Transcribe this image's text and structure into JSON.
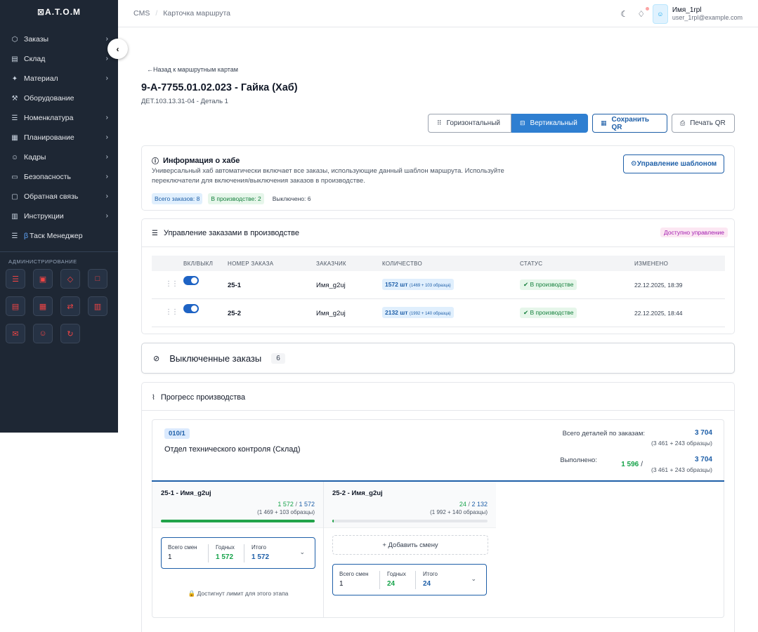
{
  "brand": {
    "logo": "⊠A.T.O.M"
  },
  "sidebar": {
    "items": [
      {
        "icon": "box-icon",
        "glyph": "⬡",
        "label": "Заказы",
        "chevron": true
      },
      {
        "icon": "warehouse-icon",
        "glyph": "▤",
        "label": "Склад",
        "chevron": true
      },
      {
        "icon": "material-icon",
        "glyph": "✦",
        "label": "Материал",
        "chevron": true
      },
      {
        "icon": "tools-icon",
        "glyph": "⚒",
        "label": "Оборудование",
        "chevron": false
      },
      {
        "icon": "list-icon",
        "glyph": "☰",
        "label": "Номенклатура",
        "chevron": true
      },
      {
        "icon": "calendar-icon",
        "glyph": "▦",
        "label": "Планирование",
        "chevron": true
      },
      {
        "icon": "users-icon",
        "glyph": "☺",
        "label": "Кадры",
        "chevron": true
      },
      {
        "icon": "monitor-icon",
        "glyph": "▭",
        "label": "Безопасность",
        "chevron": true
      },
      {
        "icon": "chat-icon",
        "glyph": "▢",
        "label": "Обратная связь",
        "chevron": true
      },
      {
        "icon": "book-icon",
        "glyph": "▥",
        "label": "Инструкции",
        "chevron": true
      }
    ],
    "task_manager": {
      "beta": "β",
      "label": "Таск Менеджер"
    },
    "admin_title": "АДМИНИСТРИРОВАНИЕ",
    "admin_icons": [
      {
        "icon": "list-admin-icon",
        "glyph": "☰"
      },
      {
        "icon": "lock-admin-icon",
        "glyph": "▣"
      },
      {
        "icon": "shield-admin-icon",
        "glyph": "◇"
      },
      {
        "icon": "file-admin-icon",
        "glyph": "□"
      },
      {
        "icon": "database-admin-icon",
        "glyph": "▤"
      },
      {
        "icon": "table-admin-icon",
        "glyph": "▦"
      },
      {
        "icon": "route-admin-icon",
        "glyph": "⇄"
      },
      {
        "icon": "printer-admin-icon",
        "glyph": "▥"
      },
      {
        "icon": "mail-admin-icon",
        "glyph": "✉"
      },
      {
        "icon": "user-admin-icon",
        "glyph": "☺"
      },
      {
        "icon": "refresh-admin-icon",
        "glyph": "↻"
      }
    ]
  },
  "header": {
    "breadcrumb": [
      "CMS",
      "Карточка маршрута"
    ],
    "user_name": "Имя_1rpl",
    "user_email": "user_1rpl@example.com"
  },
  "page": {
    "back_label": "←Назад к маршрутным картам",
    "title": "9-A-7755.01.02.023 - Гайка (Хаб)",
    "subtitle": "ДЕТ.103.13.31-04 - Деталь 1",
    "btn_horizontal": "Горизонтальный",
    "btn_vertical": "Вертикальный",
    "btn_save_qr": "Сохранить QR",
    "btn_print_qr": "Печать QR"
  },
  "info": {
    "title": "Информация о хабе",
    "text": "Универсальный хаб автоматически включает все заказы, использующие данный шаблон маршрута. Используйте переключатели для включения/выключения заказов в производстве.",
    "chip_total": "Всего заказов: 8",
    "chip_production": "В производстве: 2",
    "chip_off": "Выключено: 6",
    "btn_template": "⚙Управление шаблоном"
  },
  "orders": {
    "title": "Управление заказами в производстве",
    "badge": "Доступно управление",
    "columns": [
      "ВКЛ/ВЫКЛ",
      "НОМЕР ЗАКАЗА",
      "ЗАКАЗЧИК",
      "КОЛИЧЕСТВО",
      "СТАТУС",
      "ИЗМЕНЕНО"
    ],
    "rows": [
      {
        "number": "25-1",
        "customer": "Имя_g2uj",
        "qty": "1572 шт",
        "qty_note": "(1469 + 103 образца)",
        "status": "✔ В производстве",
        "changed": "22.12.2025, 18:39"
      },
      {
        "number": "25-2",
        "customer": "Имя_g2uj",
        "qty": "2132 шт",
        "qty_note": "(1992 + 140 образца)",
        "status": "✔ В производстве",
        "changed": "22.12.2025, 18:44"
      }
    ]
  },
  "excluded": {
    "title": "Выключенные заказы",
    "count": "6"
  },
  "progress": {
    "title": "Прогресс производства",
    "stage_code": "010/1",
    "stage_name": "Отдел технического контроля (Склад)",
    "total_label": "Всего деталей по заказам:",
    "total_value": "3 704",
    "total_sub": "(3 461 + 243 образцы)",
    "done_label": "Выполнено:",
    "done_value": "1 596",
    "done_sep": "/",
    "done_total": "3 704",
    "done_sub": "(3 461 + 243 образцы)",
    "columns": [
      {
        "title": "25-1 - Имя_g2uj",
        "done": "1 572",
        "slash": "/",
        "total": "1 572",
        "sub": "(1 469 + 103 образцы)",
        "fill": 1.0,
        "shift": {
          "l1": "Всего смен",
          "v1": "1",
          "l2": "Годных",
          "v2": "1 572",
          "l3": "Итого",
          "v3": "1 572"
        },
        "limit": "🔒 Достигнут лимит для этого этапа"
      },
      {
        "title": "25-2 - Имя_g2uj",
        "done": "24",
        "slash": "/",
        "total": "2 132",
        "sub": "(1 992 + 140 образцы)",
        "fill": 0.011,
        "add_shift": "+ Добавить смену",
        "shift": {
          "l1": "Всего смен",
          "v1": "1",
          "l2": "Годных",
          "v2": "24",
          "l3": "Итого",
          "v3": "24"
        }
      }
    ]
  },
  "colors": {
    "sidebar_bg": "#1e2734",
    "accent": "#2f7fd1",
    "primary_text": "#1e5fa8",
    "success": "#16a34a",
    "danger": "#ef4444"
  }
}
